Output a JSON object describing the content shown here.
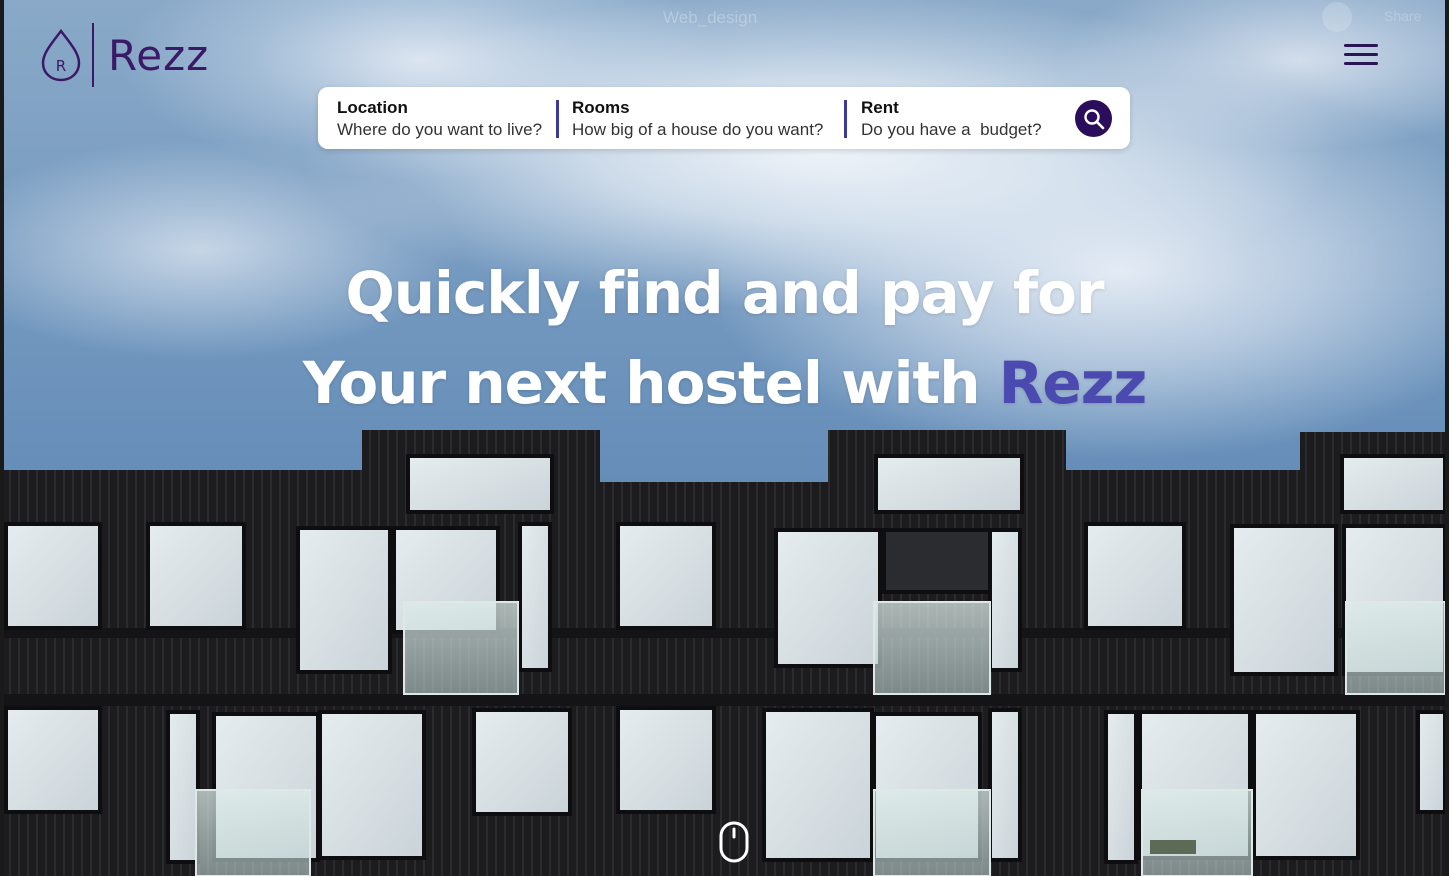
{
  "watermark": "Web_design",
  "ghost_share": "Share",
  "logo": {
    "text": "Rezz",
    "mark_letter": "R"
  },
  "search": {
    "location": {
      "label": "Location",
      "placeholder": "Where do you want to live?"
    },
    "rooms": {
      "label": "Rooms",
      "placeholder": "How big of a house do you want?"
    },
    "rent": {
      "label": "Rent",
      "placeholder": "Do you have a  budget?"
    }
  },
  "headline": {
    "line1": "Quickly find and pay for",
    "line2_prefix": "Your next hostel with ",
    "line2_brand": "Rezz"
  },
  "icons": {
    "logo": "droplet-logo-icon",
    "menu": "hamburger-menu-icon",
    "search": "search-icon",
    "scroll": "mouse-scroll-icon"
  },
  "colors": {
    "brand": "#3a1a66",
    "brand_accent": "#4a4ab0",
    "search_button": "#2a0e5c",
    "divider": "#3b3a9a"
  }
}
